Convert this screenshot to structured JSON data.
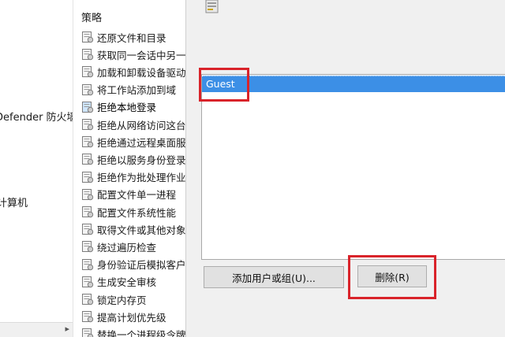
{
  "tree": {
    "items": [
      {
        "label": "Defender 防火墙"
      },
      {
        "label": "计算机"
      }
    ]
  },
  "policies": {
    "header": "策略",
    "items": [
      {
        "label": "还原文件和目录",
        "selected": false
      },
      {
        "label": "获取同一会话中另一",
        "selected": false
      },
      {
        "label": "加载和卸载设备驱动",
        "selected": false
      },
      {
        "label": "将工作站添加到域",
        "selected": false
      },
      {
        "label": "拒绝本地登录",
        "selected": true
      },
      {
        "label": "拒绝从网络访问这台",
        "selected": false
      },
      {
        "label": "拒绝通过远程桌面服",
        "selected": false
      },
      {
        "label": "拒绝以服务身份登录",
        "selected": false
      },
      {
        "label": "拒绝作为批处理作业",
        "selected": false
      },
      {
        "label": "配置文件单一进程",
        "selected": false
      },
      {
        "label": "配置文件系统性能",
        "selected": false
      },
      {
        "label": "取得文件或其他对象",
        "selected": false
      },
      {
        "label": "绕过遍历检查",
        "selected": false
      },
      {
        "label": "身份验证后模拟客户",
        "selected": false
      },
      {
        "label": "生成安全审核",
        "selected": false
      },
      {
        "label": "锁定内存页",
        "selected": false
      },
      {
        "label": "提高计划优先级",
        "selected": false
      },
      {
        "label": "替换一个进程级令牌",
        "selected": false
      }
    ]
  },
  "dialog": {
    "users": [
      {
        "name": "Guest",
        "selected": true
      }
    ],
    "add_button": "添加用户或组(U)...",
    "remove_button": "删除(R)"
  },
  "colors": {
    "selection": "#3c8fe6",
    "highlight_box": "#d9232a"
  }
}
